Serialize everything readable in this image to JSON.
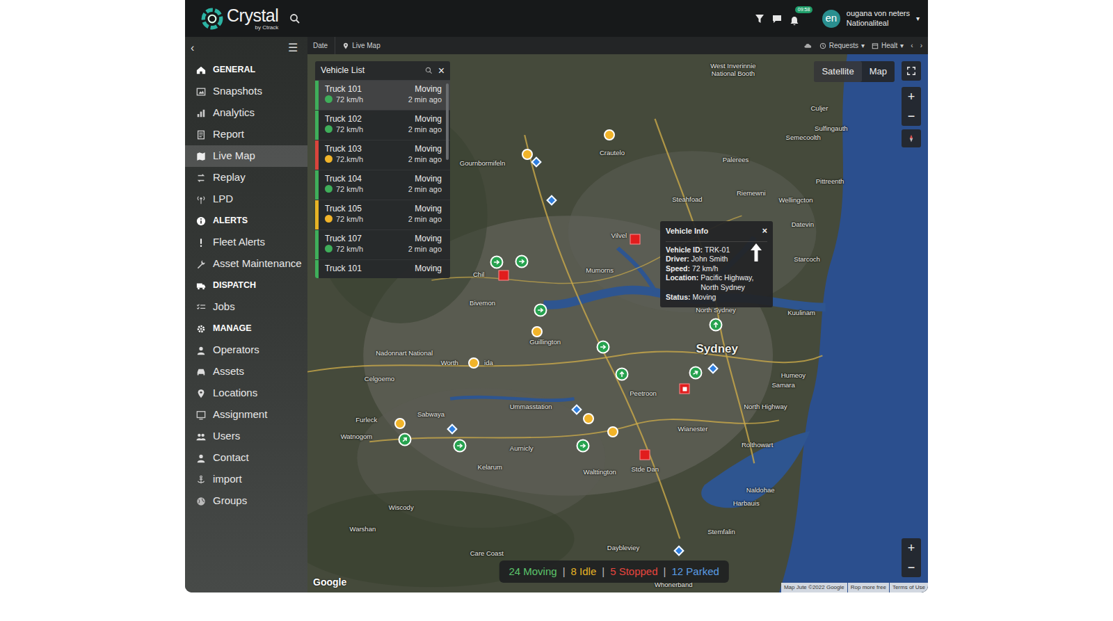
{
  "logo": {
    "name": "Crystal",
    "sub": "by Ctrack"
  },
  "topbar": {
    "badge": "09:58",
    "avatar": "en",
    "user_name": "ougana von neters",
    "user_org": "Nationaliteal",
    "caret": "▾"
  },
  "sidebar": {
    "collapse": "‹",
    "menu": "☰",
    "items": [
      {
        "kind": "header",
        "label": "GENERAL",
        "selected": false
      },
      {
        "kind": "item",
        "label": "Snapshots",
        "selected": false
      },
      {
        "kind": "item",
        "label": "Analytics",
        "selected": false
      },
      {
        "kind": "item",
        "label": "Report",
        "selected": false
      },
      {
        "kind": "item",
        "label": "Live Map",
        "selected": true
      },
      {
        "kind": "item",
        "label": "Replay",
        "selected": false
      },
      {
        "kind": "item",
        "label": "LPD",
        "selected": false
      },
      {
        "kind": "header",
        "label": "ALERTS",
        "selected": false
      },
      {
        "kind": "item",
        "label": "Fleet Alerts",
        "selected": false
      },
      {
        "kind": "item",
        "label": "Asset Maintenance",
        "selected": false
      },
      {
        "kind": "header",
        "label": "DISPATCH",
        "selected": false
      },
      {
        "kind": "item",
        "label": "Jobs",
        "selected": false
      },
      {
        "kind": "header",
        "label": "MANAGE",
        "selected": false
      },
      {
        "kind": "item",
        "label": "Operators",
        "selected": false
      },
      {
        "kind": "item",
        "label": "Assets",
        "selected": false
      },
      {
        "kind": "item",
        "label": "Locations",
        "selected": false
      },
      {
        "kind": "item",
        "label": "Assignment",
        "selected": false
      },
      {
        "kind": "item",
        "label": "Users",
        "selected": false
      },
      {
        "kind": "item",
        "label": "Contact",
        "selected": false
      },
      {
        "kind": "item",
        "label": "import",
        "selected": false
      },
      {
        "kind": "item",
        "label": "Groups",
        "selected": false
      }
    ]
  },
  "toolbar": {
    "date": "Date",
    "live_map": "Live Map",
    "requests": "Requests",
    "health": "Healt",
    "caret": "▾",
    "prev": "‹",
    "next": "›"
  },
  "map": {
    "view_toggle": [
      {
        "label": "Satellite",
        "selected": true
      },
      {
        "label": "Map",
        "selected": false
      }
    ],
    "zoom_in": "+",
    "zoom_out": "−",
    "labels": [
      "West Inverinnie National Booth",
      "Culjer",
      "Sulfingauth",
      "Semecoolth",
      "Palerees",
      "Crautelo",
      "Gournbormifeln",
      "Steahfoad",
      "Riemewni",
      "Pittreenth",
      "Wellingcton",
      "Datevin",
      "Starcoch",
      "Vilvel",
      "Mumorns",
      "Chil",
      "Bivemon",
      "North Sydney",
      "Sydney",
      "Kuulinam",
      "Guillington",
      "Nadonnart National",
      "Worth",
      "ida",
      "Celgoemo",
      "Furleck",
      "Watnogom",
      "Sabwaya",
      "Ummasstation",
      "Peetroon",
      "Humeoy",
      "Samara",
      "North Highway",
      "Wianester",
      "Rolthowart",
      "Aurnicly",
      "Kelarum",
      "Walttington",
      "Stde Dan",
      "Naldohae",
      "Harbauis",
      "Wiscody",
      "Warshan",
      "Stemfalin",
      "Daybleviey",
      "Care Coast",
      "Whonerband"
    ],
    "pins": [
      {
        "kind": "idle"
      },
      {
        "kind": "idle"
      },
      {
        "kind": "parked"
      },
      {
        "kind": "parked"
      },
      {
        "kind": "stopped"
      },
      {
        "kind": "moving"
      },
      {
        "kind": "moving"
      },
      {
        "kind": "stopped"
      },
      {
        "kind": "moving"
      },
      {
        "kind": "idle"
      },
      {
        "kind": "moving"
      },
      {
        "kind": "moving"
      },
      {
        "kind": "moving"
      },
      {
        "kind": "parked"
      },
      {
        "kind": "moving"
      },
      {
        "kind": "stopped"
      },
      {
        "kind": "idle"
      },
      {
        "kind": "parked"
      },
      {
        "kind": "idle"
      },
      {
        "kind": "idle"
      },
      {
        "kind": "stopped"
      },
      {
        "kind": "moving"
      },
      {
        "kind": "moving"
      },
      {
        "kind": "parked"
      },
      {
        "kind": "idle"
      },
      {
        "kind": "moving"
      },
      {
        "kind": "parked"
      }
    ],
    "google": "Google",
    "attribution": [
      "Map Jute ©2022 Google",
      "Rop more free",
      "Terms of Use"
    ]
  },
  "vehicle_list": {
    "title": "Vehicle List",
    "close": "×",
    "rows": [
      {
        "name": "Truck 101",
        "status": "Moving",
        "speed": "72 km/h",
        "time": "2 min ago",
        "bar_color": "#3fae5a",
        "dot_color": "#3fae5a",
        "selected": true
      },
      {
        "name": "Truck 102",
        "status": "Moving",
        "speed": "72 km/h",
        "time": "2 min ago",
        "bar_color": "#3fae5a",
        "dot_color": "#3fae5a",
        "selected": false
      },
      {
        "name": "Truck 103",
        "status": "Moving",
        "speed": "72.km/h",
        "time": "2 min ago",
        "bar_color": "#d9443c",
        "dot_color": "#f1b42a",
        "selected": false
      },
      {
        "name": "Truck 104",
        "status": "Moving",
        "speed": "72 km/h",
        "time": "2 min ago",
        "bar_color": "#3fae5a",
        "dot_color": "#3fae5a",
        "selected": false
      },
      {
        "name": "Truck 105",
        "status": "Moving",
        "speed": "72 km/h",
        "time": "2 min ago",
        "bar_color": "#e6b325",
        "dot_color": "#f1b42a",
        "selected": false
      },
      {
        "name": "Truck 107",
        "status": "Moving",
        "speed": "72 km/h",
        "time": "2 min ago",
        "bar_color": "#3fae5a",
        "dot_color": "#3fae5a",
        "selected": false
      },
      {
        "name": "Truck 101",
        "status": "Moving",
        "bar_color": "#3fae5a",
        "selected": false
      }
    ]
  },
  "vehicle_info": {
    "title": "Vehicle Info",
    "close": "×",
    "fields": [
      {
        "label": "Vehicle ID:",
        "value": "TRK-01"
      },
      {
        "label": "Driver:",
        "value": "John Smith"
      },
      {
        "label": "Speed:",
        "value": "72 km/h"
      },
      {
        "label": "Location:",
        "value": "Pacific Highway, North Sydney"
      },
      {
        "label": "Status:",
        "value": "Moving"
      }
    ]
  },
  "status_bar": {
    "separator": "|",
    "items": [
      {
        "text": "24 Moving",
        "color": "#5cc46b"
      },
      {
        "text": "8 Idle",
        "color": "#e6b325"
      },
      {
        "text": "5 Stopped",
        "color": "#e8453e"
      },
      {
        "text": "12 Parked",
        "color": "#5a9de6"
      }
    ]
  }
}
